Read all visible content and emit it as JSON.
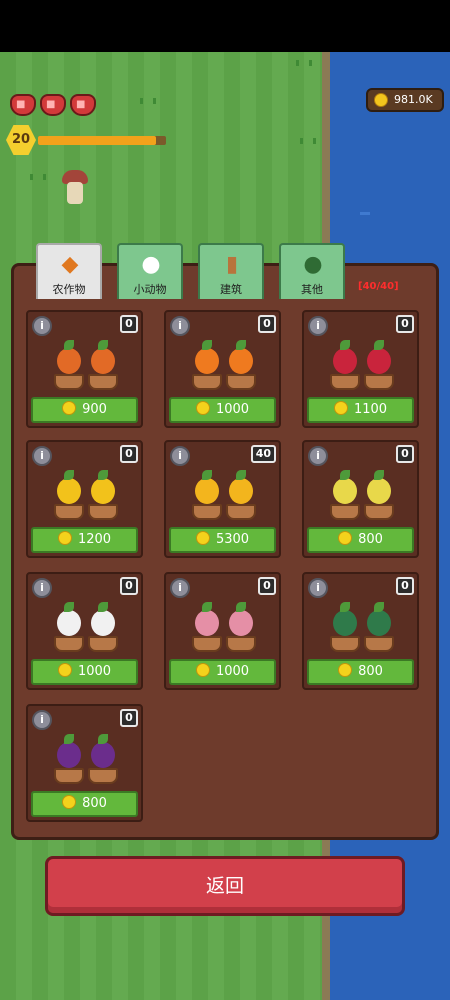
{
  "hud": {
    "hearts": 3,
    "level": "20",
    "xp_fraction": 0.92,
    "coins": "981.0K"
  },
  "tabs": [
    {
      "label": "农作物",
      "icon": "carrot-icon",
      "active": true
    },
    {
      "label": "小动物",
      "icon": "chicken-icon",
      "active": false
    },
    {
      "label": "建筑",
      "icon": "wood-log-icon",
      "active": false
    },
    {
      "label": "其他",
      "icon": "goblin-icon",
      "active": false
    }
  ],
  "slots_text": "[40/40]",
  "items": [
    {
      "name": "carrot-seedling",
      "count": "0",
      "price": "900",
      "color": "#e26a26"
    },
    {
      "name": "pumpkin",
      "count": "0",
      "price": "1000",
      "color": "#ef7a1f"
    },
    {
      "name": "radish",
      "count": "0",
      "price": "1100",
      "color": "#c9243c"
    },
    {
      "name": "sunflower",
      "count": "0",
      "price": "1200",
      "color": "#f2c21b"
    },
    {
      "name": "corn",
      "count": "40",
      "price": "5300",
      "color": "#f3b51d"
    },
    {
      "name": "wheat-bush",
      "count": "0",
      "price": "800",
      "color": "#e8d84a"
    },
    {
      "name": "cotton",
      "count": "0",
      "price": "1000",
      "color": "#f1f1f1"
    },
    {
      "name": "flower-bush",
      "count": "0",
      "price": "1000",
      "color": "#e58fa6"
    },
    {
      "name": "cabbage",
      "count": "0",
      "price": "800",
      "color": "#2f7a4a"
    },
    {
      "name": "eggplant",
      "count": "0",
      "price": "800",
      "color": "#6b2d8c"
    }
  ],
  "back_label": "返回"
}
